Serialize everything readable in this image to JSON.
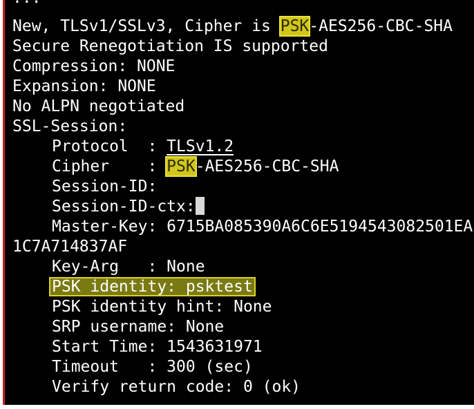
{
  "partial_top": "...",
  "lines": {
    "l1_pre": "New, TLSv1/SSLv3, Cipher is ",
    "l1_psk": "PSK",
    "l1_dash": "-",
    "l1_post": "AES256-CBC-SHA",
    "l2": "Secure Renegotiation IS supported",
    "l3": "Compression: NONE",
    "l4": "Expansion: NONE",
    "l5": "No ALPN negotiated",
    "l6": "SSL-Session:",
    "l7_label": "Protocol  : ",
    "l7_value": "TLSv1.2",
    "l8_label": "Cipher    : ",
    "l8_psk": "PSK",
    "l8_dash": "-",
    "l8_post": "AES256-CBC-SHA",
    "l9": "Session-ID:",
    "l10": "Session-ID-ctx:",
    "l11": "Master-Key: 6715BA085390A6C6E5194543082501EA",
    "l12": "1C7A714837AF",
    "l13": "Key-Arg   : None",
    "l14": "PSK identity: psktest",
    "l15": "PSK identity hint: None",
    "l16": "SRP username: None",
    "l17": "Start Time: 1543631971",
    "l18": "Timeout   : 300 (sec)",
    "l19": "Verify return code: 0 (ok)"
  },
  "colors": {
    "terminal_bg": "#000000",
    "text": "#ffffff",
    "highlight_fill": "#d1c61c",
    "highlight_border": "#e9e23a",
    "left_bar": "#cc1f1f"
  }
}
